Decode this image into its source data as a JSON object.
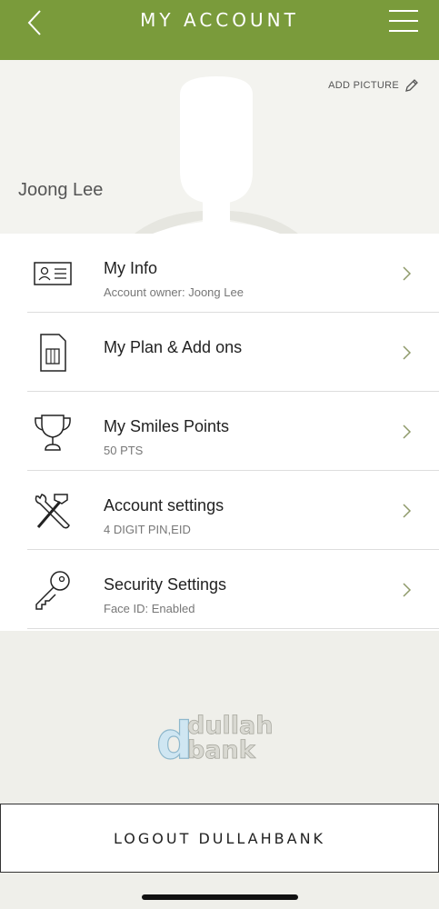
{
  "header": {
    "title": "MY ACCOUNT"
  },
  "profile": {
    "name": "Joong Lee",
    "add_picture_label": "ADD PICTURE"
  },
  "menu_items": [
    {
      "label": "My Info",
      "sub": "Account owner: Joong Lee",
      "icon": "id-card-icon"
    },
    {
      "label": "My Plan & Add ons",
      "sub": "",
      "icon": "sim-card-icon"
    },
    {
      "label": "My Smiles Points",
      "sub": "50 PTS",
      "icon": "trophy-icon"
    },
    {
      "label": "Account settings",
      "sub": "4 DIGIT PIN,EID",
      "icon": "tools-icon"
    },
    {
      "label": "Security Settings",
      "sub": "Face ID: Enabled",
      "icon": "key-icon"
    }
  ],
  "watermark": {
    "line1": "dullah",
    "line2": "bank"
  },
  "logout": {
    "label": "LOGOUT DULLAHBANK"
  },
  "colors": {
    "header_bg": "#7a9b3b",
    "chevron": "#8f9a6a"
  }
}
